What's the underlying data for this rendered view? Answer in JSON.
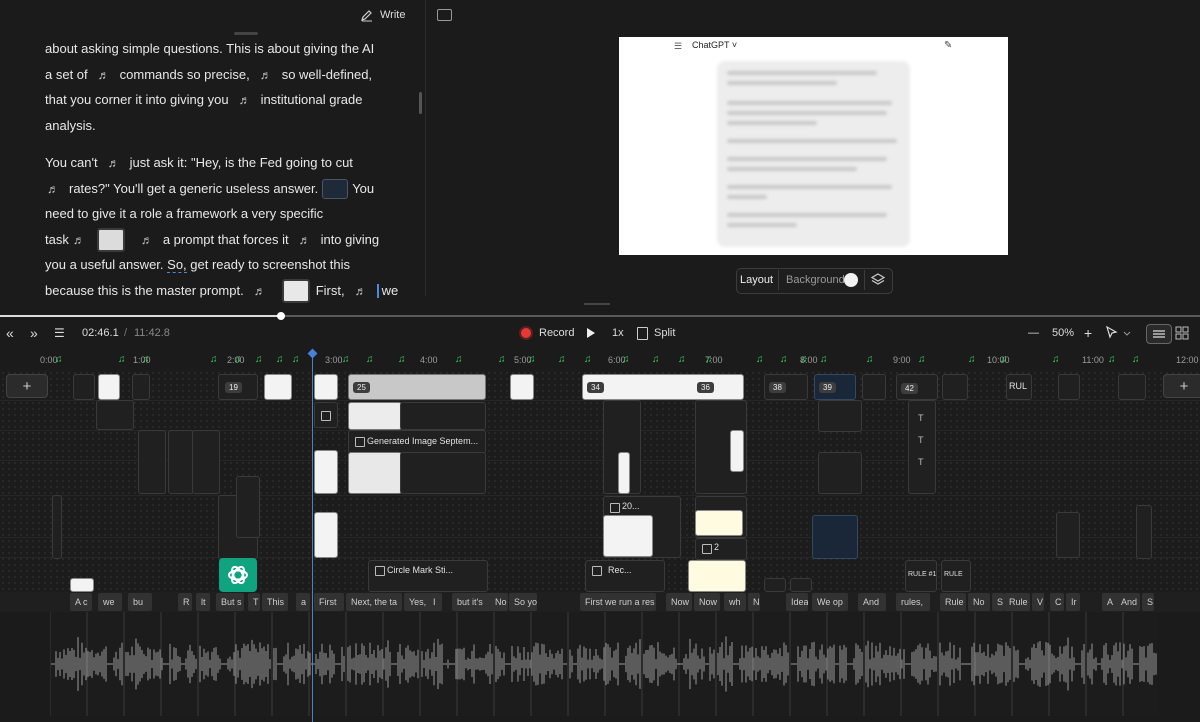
{
  "editor": {
    "write_label": "Write",
    "para1": [
      "about asking simple questions. This is about giving the AI",
      [
        "a set of",
        "commands so precise,",
        "so well-defined,"
      ],
      [
        "that you corner it into giving you",
        "institutional grade"
      ],
      "analysis."
    ],
    "para2": {
      "l1a": "You can't",
      "l1b": "just ask it: \"Hey, is the Fed going to cut",
      "l2a": "rates?\" You'll get a generic useless answer.",
      "l2b": "You",
      "l3": "need to give it a role a framework a very specific",
      "l4a": "task",
      "l4b": "a prompt that forces it",
      "l4c": "into giving",
      "l5a": "you a useful answer.",
      "l5b": "So,",
      "l5c": "get ready to screenshot this",
      "l6a": "because this is the master prompt.",
      "l6b": "First,",
      "l6c": "we"
    },
    "note_glyph": "♬"
  },
  "preview": {
    "chat_title": "ChatGPT ˅",
    "menu_glyph": "☰",
    "edit_glyph": "✎",
    "layout_label": "Layout",
    "background_label": "Background"
  },
  "controls": {
    "rewind": "«",
    "forward": "»",
    "chapters_glyph": "☰",
    "current_time": "02:46.1",
    "divider": "/",
    "total_time": "11:42.8",
    "record_label": "Record",
    "speed": "1x",
    "split_label": "Split",
    "zoom_minus": "—",
    "zoom": "50%",
    "zoom_plus": "+"
  },
  "ruler": [
    "0:00",
    "1:00",
    "2:00",
    "3:00",
    "4:00",
    "5:00",
    "6:00",
    "7:00",
    "8:00",
    "9:00",
    "10:00",
    "11:00",
    "12:00"
  ],
  "clips": {
    "c19": "19",
    "c25": "25",
    "c34": "34",
    "c36": "36",
    "c38": "38",
    "c39": "39",
    "c42": "42",
    "generated_image": "Generated Image Septem...",
    "circle_mark": "Circle Mark Sti...",
    "rec": "Rec...",
    "twenty": "20...",
    "rule1": "RULE #1",
    "rule2": "RULE",
    "rul": "RUL",
    "two": "2"
  },
  "captions": [
    "A c",
    "we",
    "bu",
    "R",
    "lt",
    "But s",
    "T",
    "This",
    "a",
    "First",
    "Next, the ta",
    "Yes,",
    "I",
    "but it's",
    "No",
    "So yo",
    "First we run a res",
    "Now",
    "Now",
    "wh",
    "N",
    "Idea",
    "We op",
    "And",
    "rules,",
    "Rule",
    "No",
    "S",
    "Rule",
    "V",
    "C",
    "Ir",
    "A",
    "And",
    "S"
  ]
}
